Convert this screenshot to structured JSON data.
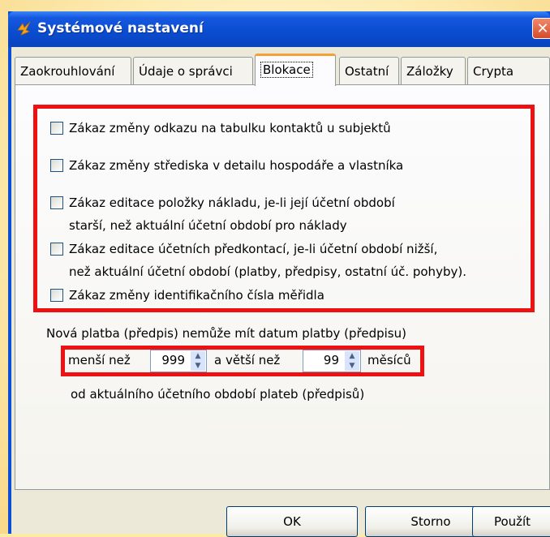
{
  "window": {
    "title": "Systémové nastavení",
    "close_glyph": "✕"
  },
  "tabs": [
    {
      "label": "Zaokrouhlování",
      "active": false
    },
    {
      "label": "Údaje o správci",
      "active": false
    },
    {
      "label": "Blokace",
      "active": true
    },
    {
      "label": "Ostatní",
      "active": false
    },
    {
      "label": "Záložky",
      "active": false
    },
    {
      "label": "Crypta",
      "active": false
    }
  ],
  "checkboxes": [
    {
      "line1": "Zákaz změny odkazu na tabulku kontaktů u subjektů",
      "line2": "",
      "checked": false
    },
    {
      "line1": "Zákaz změny střediska v detailu hospodáře a vlastníka",
      "line2": "",
      "checked": false
    },
    {
      "line1": "Zákaz editace položky nákladu, je-li její účetní období",
      "line2": "starší, než aktuální účetní období pro náklady",
      "checked": false
    },
    {
      "line1": "Zákaz editace účetních předkontací, je-li účetní období nižší,",
      "line2": "než aktuální účetní období (platby, předpisy, ostatní úč. pohyby).",
      "checked": false
    },
    {
      "line1": "Zákaz změny identifikačního čísla měřidla",
      "line2": "",
      "checked": false
    }
  ],
  "payment": {
    "intro": "Nová platba (předpis) nemůže mít datum platby (předpisu)",
    "less_label": "menší než",
    "less_value": "999",
    "greater_label": "a větší než",
    "greater_value": "99",
    "unit": "měsíců",
    "footer": "od aktuálního účetního období plateb (předpisů)"
  },
  "buttons": {
    "ok": "OK",
    "cancel": "Storno",
    "apply": "Použít"
  },
  "colors": {
    "highlight": "#ee1111",
    "titlebar": "#0a4ccf",
    "active_tab_accent": "#f1a136"
  }
}
